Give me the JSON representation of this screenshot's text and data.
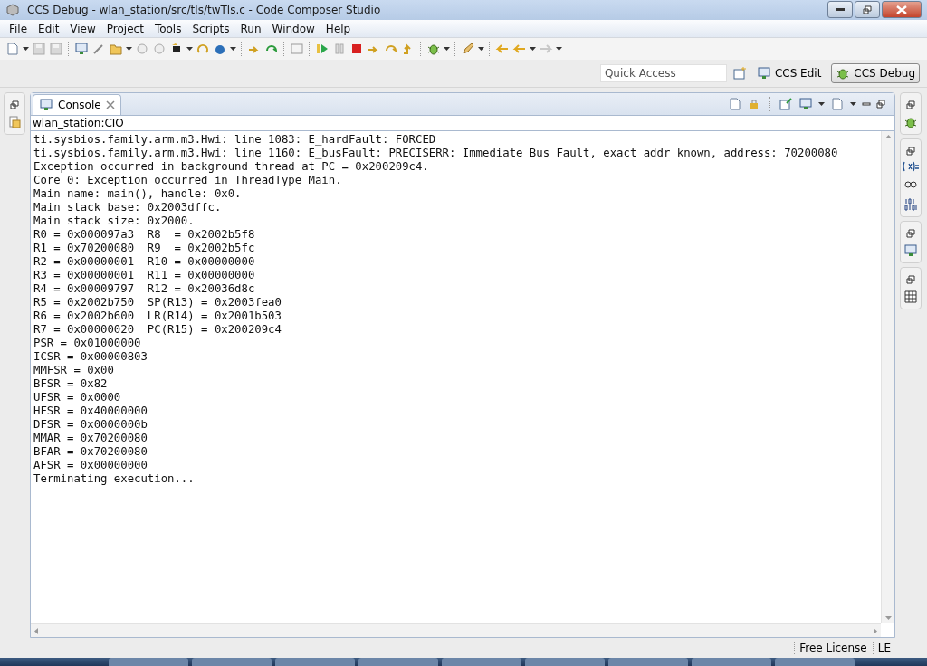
{
  "window": {
    "title": "CCS Debug - wlan_station/src/tls/twTls.c - Code Composer Studio"
  },
  "menu": [
    {
      "label": "File"
    },
    {
      "label": "Edit"
    },
    {
      "label": "View"
    },
    {
      "label": "Project"
    },
    {
      "label": "Tools"
    },
    {
      "label": "Scripts"
    },
    {
      "label": "Run"
    },
    {
      "label": "Window"
    },
    {
      "label": "Help"
    }
  ],
  "quick_access": {
    "placeholder": "Quick Access"
  },
  "perspectives": [
    {
      "label": "CCS Edit",
      "selected": false
    },
    {
      "label": "CCS Debug",
      "selected": true
    }
  ],
  "console": {
    "tab": "Console",
    "subtitle": "wlan_station:CIO",
    "lines": [
      "ti.sysbios.family.arm.m3.Hwi: line 1083: E_hardFault: FORCED",
      "ti.sysbios.family.arm.m3.Hwi: line 1160: E_busFault: PRECISERR: Immediate Bus Fault, exact addr known, address: 70200080",
      "Exception occurred in background thread at PC = 0x200209c4.",
      "Core 0: Exception occurred in ThreadType_Main.",
      "Main name: main(), handle: 0x0.",
      "Main stack base: 0x2003dffc.",
      "Main stack size: 0x2000.",
      "R0 = 0x000097a3  R8  = 0x2002b5f8",
      "R1 = 0x70200080  R9  = 0x2002b5fc",
      "R2 = 0x00000001  R10 = 0x00000000",
      "R3 = 0x00000001  R11 = 0x00000000",
      "R4 = 0x00009797  R12 = 0x20036d8c",
      "R5 = 0x2002b750  SP(R13) = 0x2003fea0",
      "R6 = 0x2002b600  LR(R14) = 0x2001b503",
      "R7 = 0x00000020  PC(R15) = 0x200209c4",
      "PSR = 0x01000000",
      "ICSR = 0x00000803",
      "MMFSR = 0x00",
      "BFSR = 0x82",
      "UFSR = 0x0000",
      "HFSR = 0x40000000",
      "DFSR = 0x0000000b",
      "MMAR = 0x70200080",
      "BFAR = 0x70200080",
      "AFSR = 0x00000000",
      "Terminating execution..."
    ]
  },
  "status_bar": [
    "Free License",
    "LE"
  ]
}
